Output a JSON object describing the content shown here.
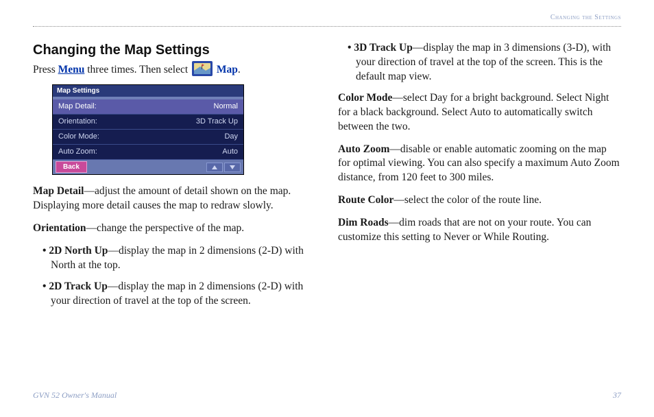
{
  "header": {
    "section_label": "Changing the Settings"
  },
  "left": {
    "title": "Changing the Map Settings",
    "intro_prefix": "Press ",
    "menu_word": "Menu",
    "intro_mid": " three times. Then select ",
    "map_word": "Map",
    "intro_suffix": ".",
    "screenshot": {
      "title": "Map Settings",
      "rows": [
        {
          "label": "Map Detail:",
          "value": "Normal"
        },
        {
          "label": "Orientation:",
          "value": "3D Track Up"
        },
        {
          "label": "Color Mode:",
          "value": "Day"
        },
        {
          "label": "Auto Zoom:",
          "value": "Auto"
        }
      ],
      "back": "Back"
    },
    "map_detail_term": "Map Detail",
    "map_detail_text": "—adjust the amount of detail shown on the map. Displaying more detail causes the map to redraw slowly.",
    "orientation_term": "Orientation",
    "orientation_text": "—change the perspective of the map.",
    "b1_term": "2D North Up",
    "b1_text": "—display the map in 2 dimensions (2-D) with North at the top.",
    "b2_term": "2D Track Up",
    "b2_text": "—display the map in 2 dimensions (2-D) with your direction of travel at the top of the screen."
  },
  "right": {
    "b3_term": "3D Track Up",
    "b3_text": "—display the map in 3 dimensions (3-D), with your direction of travel at the top of the screen. This is the default map view.",
    "color_term": "Color Mode",
    "color_text": "—select Day for a bright background. Select Night for a black background. Select Auto to automatically switch between the two.",
    "zoom_term": "Auto Zoom",
    "zoom_text": "—disable or enable automatic zooming on the map for optimal viewing. You can also specify a maximum Auto Zoom distance, from 120 feet to 300 miles.",
    "route_term": "Route Color",
    "route_text": "—select the color of the route line.",
    "dim_term": "Dim Roads",
    "dim_text": "—dim roads that are not on your route. You can customize this setting to Never or While Routing."
  },
  "footer": {
    "left": "GVN 52 Owner's Manual",
    "right": "37"
  }
}
